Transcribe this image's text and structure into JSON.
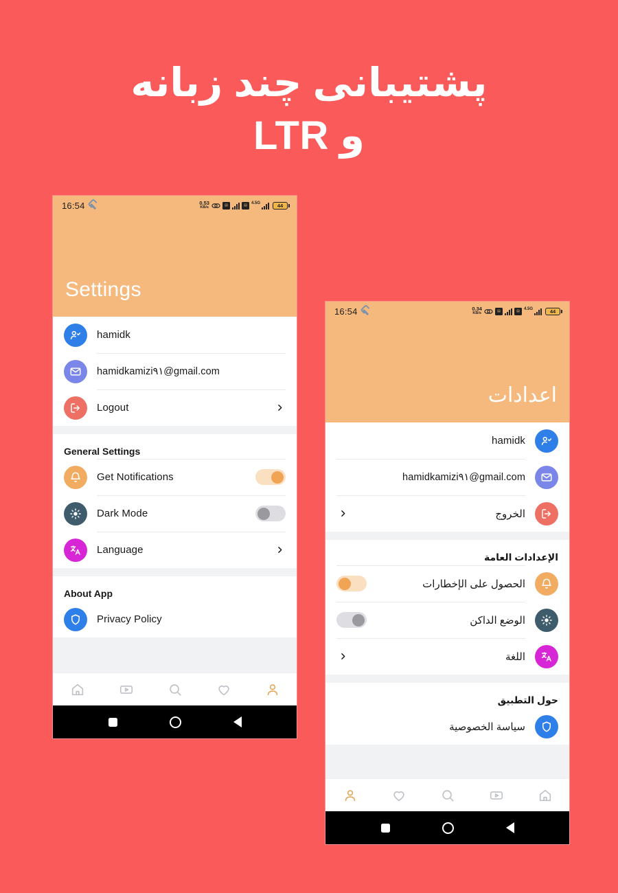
{
  "headline": {
    "line1": "پشتیبانی چند زبانه",
    "line2": "و LTR"
  },
  "colors": {
    "background": "#FB5A5A",
    "header": "#F5B97E",
    "accent_orange": "#F2A455",
    "toggle_on_track": "#FBDFC1",
    "toggle_off_track": "#DEDEE2",
    "icon_user": "#2F7FE8",
    "icon_mail": "#7B87E8",
    "icon_logout": "#EE6F63",
    "icon_bell": "#F2AC62",
    "icon_darkmode": "#3E5C6B",
    "icon_language": "#D626D6",
    "icon_privacy": "#2F7FE8",
    "nav_active": "#E3A85C",
    "nav_inactive": "#BFC2C7"
  },
  "phone_ltr": {
    "status_bar": {
      "time": "16:54",
      "wrench": "wrench-icon",
      "net_rate": "0.53",
      "net_unit": "KB/s",
      "network_gen": "4.5G",
      "battery": "44"
    },
    "header": {
      "title": "Settings"
    },
    "account": {
      "rows": [
        {
          "icon": "user-check-icon",
          "label": "hamidk",
          "chevron": false
        },
        {
          "icon": "mail-icon",
          "label": "hamidkamizi۹۱@gmail.com",
          "chevron": false
        },
        {
          "icon": "logout-icon",
          "label": "Logout",
          "chevron": true
        }
      ]
    },
    "general": {
      "title": "General Settings",
      "rows": [
        {
          "icon": "bell-icon",
          "label": "Get Notifications",
          "toggle": "on"
        },
        {
          "icon": "brightness-icon",
          "label": "Dark Mode",
          "toggle": "off"
        },
        {
          "icon": "translate-icon",
          "label": "Language",
          "chevron": true
        }
      ]
    },
    "about": {
      "title": "About App",
      "rows": [
        {
          "icon": "privacy-icon",
          "label": "Privacy Policy"
        }
      ]
    },
    "bottom_nav": [
      {
        "icon": "home-icon",
        "active": false
      },
      {
        "icon": "video-icon",
        "active": false
      },
      {
        "icon": "search-icon",
        "active": false
      },
      {
        "icon": "heart-icon",
        "active": false
      },
      {
        "icon": "person-icon",
        "active": true
      }
    ],
    "android_nav": [
      "recents-square",
      "home-circle",
      "back-triangle"
    ]
  },
  "phone_rtl": {
    "status_bar": {
      "time": "16:54",
      "wrench": "wrench-icon",
      "net_rate": "0.34",
      "net_unit": "KB/s",
      "network_gen": "4.5G",
      "battery": "44"
    },
    "header": {
      "title": "اعدادات"
    },
    "account": {
      "rows": [
        {
          "icon": "user-check-icon",
          "label": "hamidk",
          "chevron": false
        },
        {
          "icon": "mail-icon",
          "label": "hamidkamizi۹۱@gmail.com",
          "chevron": false
        },
        {
          "icon": "logout-icon",
          "label": "الخروج",
          "chevron": true
        }
      ]
    },
    "general": {
      "title": "الإعدادات العامة",
      "rows": [
        {
          "icon": "bell-icon",
          "label": "الحصول على الإخطارات",
          "toggle": "on"
        },
        {
          "icon": "brightness-icon",
          "label": "الوضع الداكن",
          "toggle": "off"
        },
        {
          "icon": "translate-icon",
          "label": "اللغة",
          "chevron": true
        }
      ]
    },
    "about": {
      "title": "حول التطبيق",
      "rows": [
        {
          "icon": "privacy-icon",
          "label": "سياسة الخصوصية"
        }
      ]
    },
    "bottom_nav": [
      {
        "icon": "home-icon",
        "active": false
      },
      {
        "icon": "video-icon",
        "active": false
      },
      {
        "icon": "search-icon",
        "active": false
      },
      {
        "icon": "heart-icon",
        "active": false
      },
      {
        "icon": "person-icon",
        "active": true
      }
    ],
    "android_nav": [
      "recents-square",
      "home-circle",
      "back-triangle"
    ]
  }
}
